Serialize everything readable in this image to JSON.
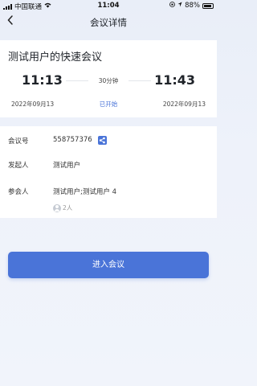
{
  "status_bar": {
    "carrier": "中国联通",
    "time": "11:04",
    "battery": "88%"
  },
  "nav": {
    "title": "会议详情"
  },
  "meeting": {
    "title": "测试用户的快速会议",
    "start_time": "11:13",
    "end_time": "11:43",
    "duration": "30分钟",
    "start_date": "2022年09月13",
    "end_date": "2022年09月13",
    "state": "已开始"
  },
  "info": {
    "meeting_id_label": "会议号",
    "meeting_id": "558757376",
    "host_label": "发起人",
    "host": "测试用户",
    "participants_label": "参会人",
    "participants": "测试用户;测试用户 4",
    "participant_count": "2人"
  },
  "actions": {
    "enter_label": "进入会议"
  },
  "colors": {
    "accent": "#4a74d8"
  }
}
